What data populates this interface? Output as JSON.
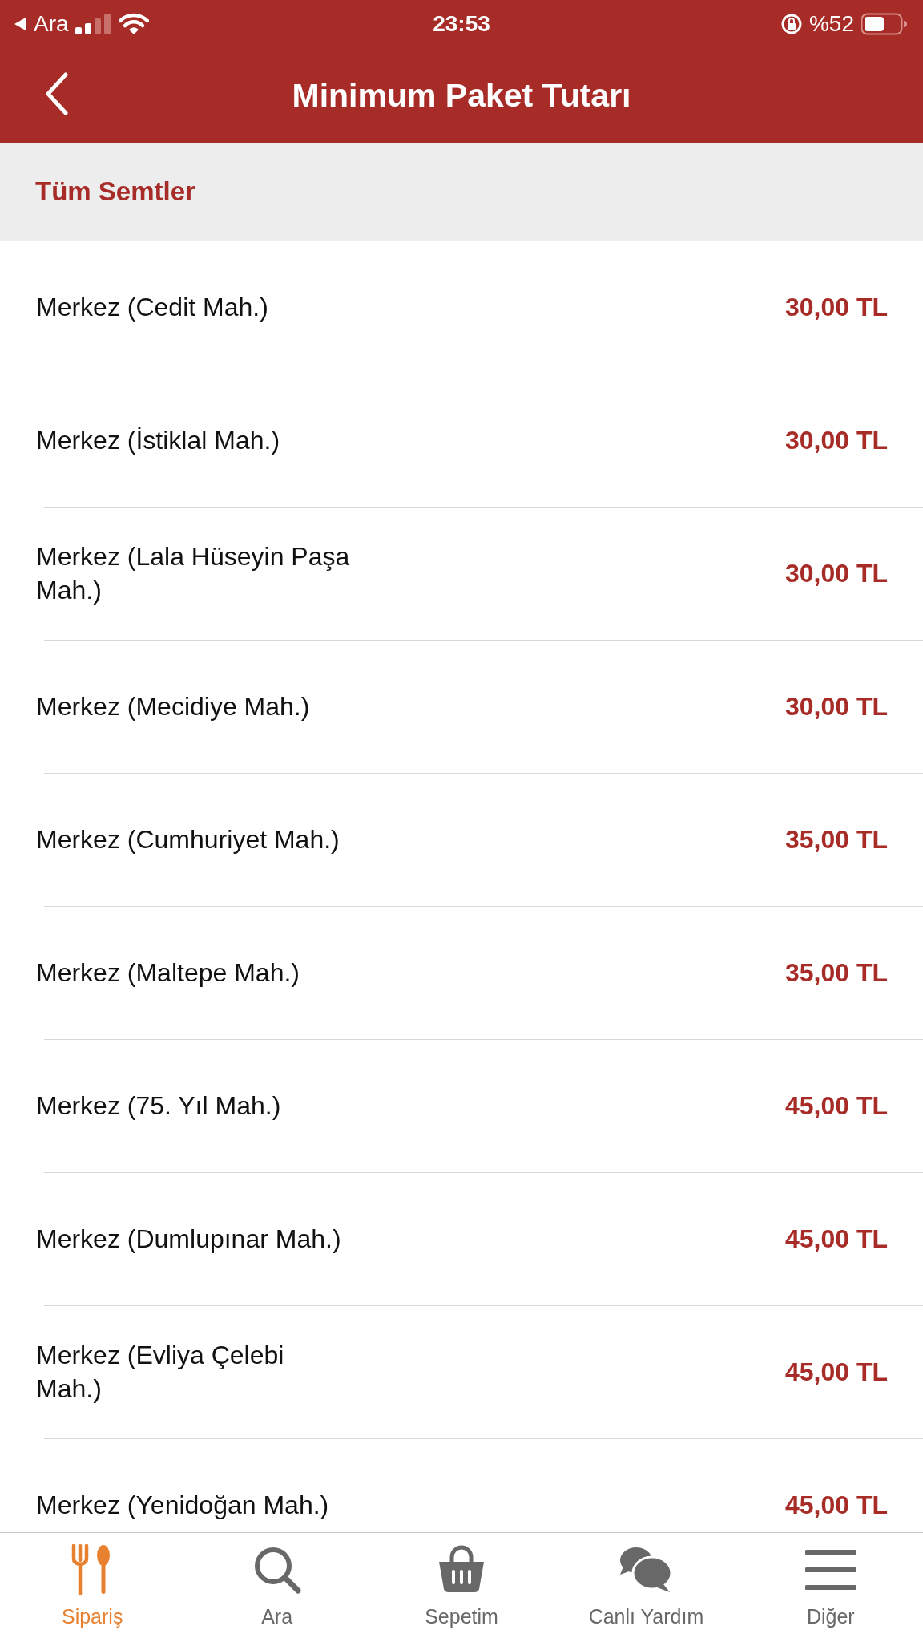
{
  "status_bar": {
    "back_label": "Ara",
    "time": "23:53",
    "battery": "%52"
  },
  "nav_bar": {
    "title": "Minimum Paket Tutarı"
  },
  "section_header": "Tüm Semtler",
  "rows": [
    {
      "name": "Merkez (Cedit Mah.)",
      "price": "30,00 TL"
    },
    {
      "name": "Merkez (İstiklal Mah.)",
      "price": "30,00 TL"
    },
    {
      "name": "Merkez (Lala Hüseyin Paşa Mah.)",
      "price": "30,00 TL"
    },
    {
      "name": "Merkez (Mecidiye Mah.)",
      "price": "30,00 TL"
    },
    {
      "name": "Merkez (Cumhuriyet Mah.)",
      "price": "35,00 TL"
    },
    {
      "name": "Merkez (Maltepe Mah.)",
      "price": "35,00 TL"
    },
    {
      "name": "Merkez (75. Yıl Mah.)",
      "price": "45,00 TL"
    },
    {
      "name": "Merkez (Dumlupınar Mah.)",
      "price": "45,00 TL"
    },
    {
      "name": "Merkez (Evliya Çelebi Mah.)",
      "price": "45,00 TL"
    },
    {
      "name": "Merkez (Yenidoğan Mah.)",
      "price": "45,00 TL"
    }
  ],
  "tab_bar": [
    {
      "kind": "order",
      "label": "Sipariş",
      "selected": true
    },
    {
      "kind": "search",
      "label": "Ara",
      "selected": false
    },
    {
      "kind": "basket",
      "label": "Sepetim",
      "selected": false
    },
    {
      "kind": "chat",
      "label": "Canlı Yardım",
      "selected": false
    },
    {
      "kind": "menu",
      "label": "Diğer",
      "selected": false
    }
  ]
}
